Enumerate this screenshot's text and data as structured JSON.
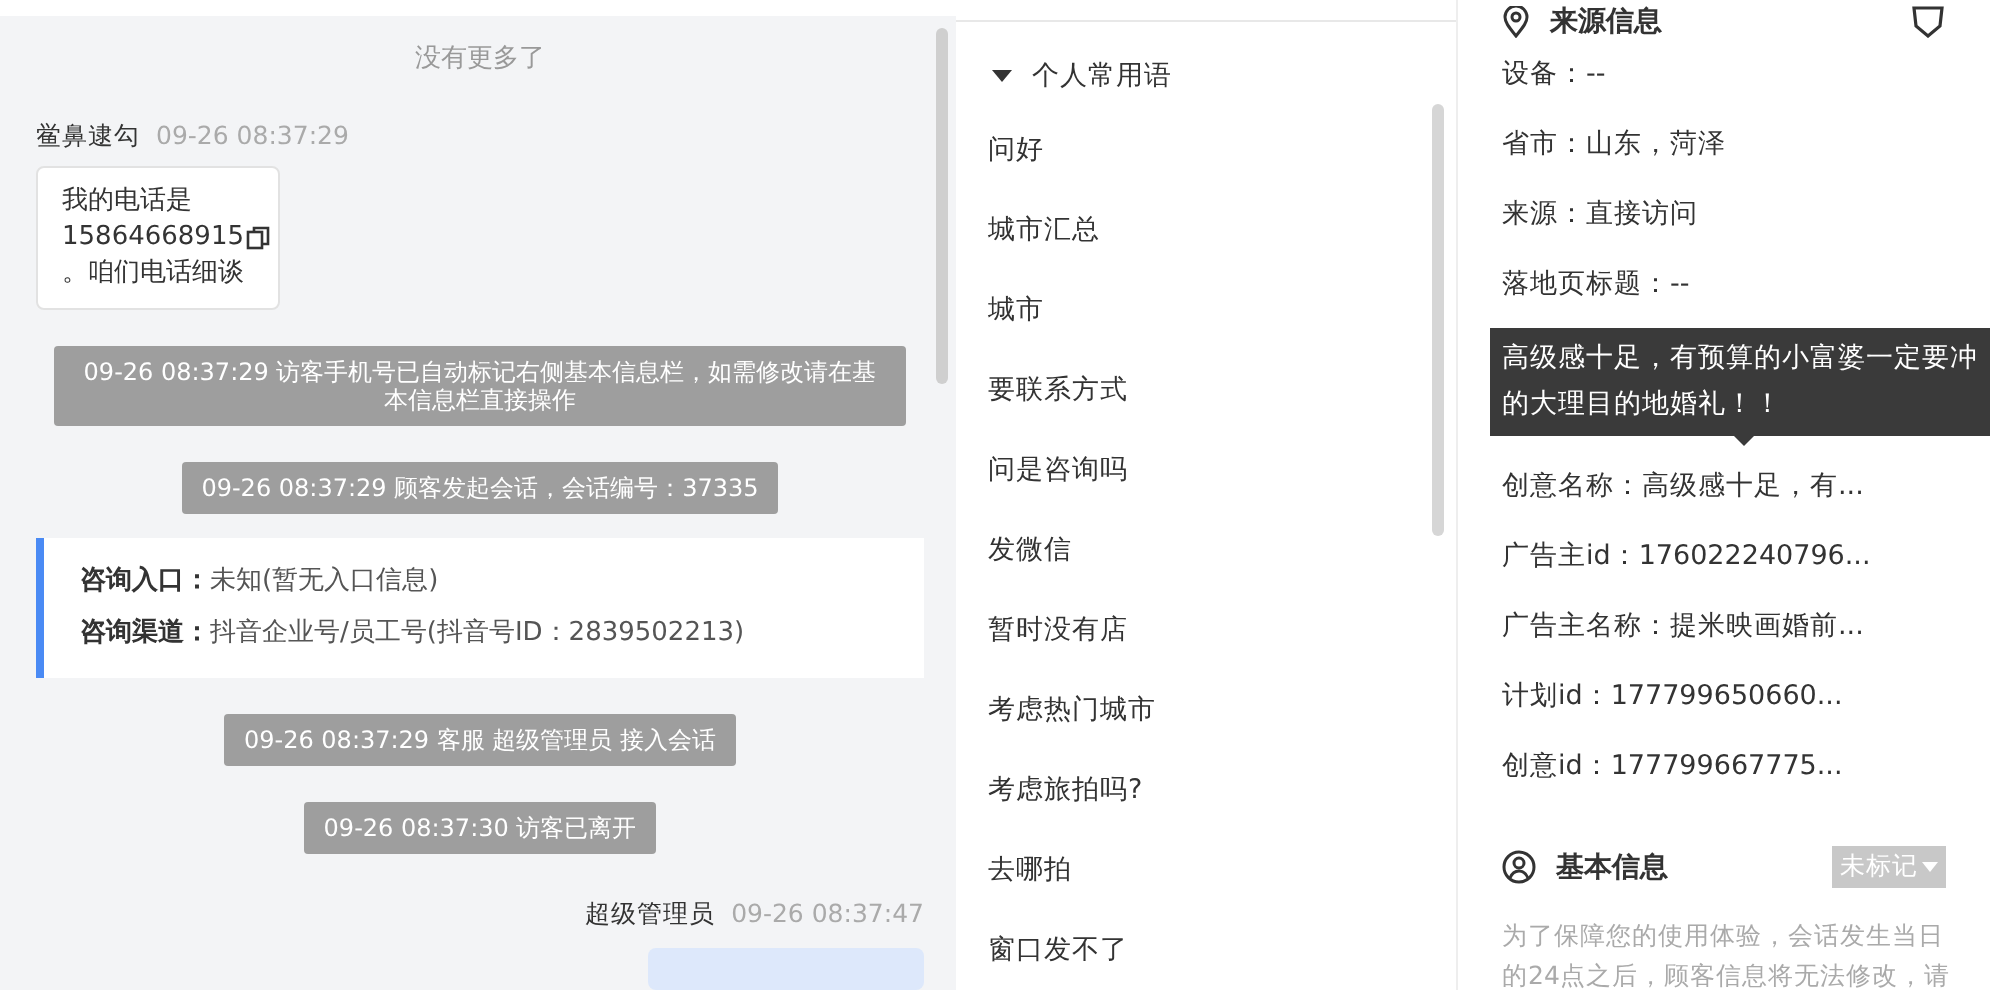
{
  "chat": {
    "no_more": "没有更多了",
    "messages": [
      {
        "kind": "visitor",
        "name": "鲎鼻逮勾",
        "time": "09-26 08:37:29",
        "text_before": "我的电话是",
        "phone": "15864668915",
        "text_after": "。咱们电话细谈"
      },
      {
        "kind": "system",
        "text": "09-26 08:37:29 访客手机号已自动标记右侧基本信息栏，如需修改请在基本信息栏直接操作",
        "wide": true
      },
      {
        "kind": "system",
        "text": "09-26 08:37:29 顾客发起会话，会话编号：37335",
        "wide": false
      },
      {
        "kind": "info",
        "rows": [
          {
            "label": "咨询入口：",
            "value": "未知(暂无入口信息)"
          },
          {
            "label": "咨询渠道：",
            "value": "抖音企业号/员工号(抖音号ID：2839502213)"
          }
        ]
      },
      {
        "kind": "system",
        "text": "09-26 08:37:29 客服 超级管理员 接入会话",
        "wide": false
      },
      {
        "kind": "system",
        "text": "09-26 08:37:30 访客已离开",
        "wide": false
      },
      {
        "kind": "agent",
        "name": "超级管理员",
        "time": "09-26 08:37:47"
      }
    ]
  },
  "phrases": {
    "group": {
      "label": "个人常用语",
      "expanded": true
    },
    "items": [
      "问好",
      "城市汇总",
      "城市",
      "要联系方式",
      "问是咨询吗",
      "发微信",
      "暂时没有店",
      "考虑热门城市",
      "考虑旅拍吗?",
      "去哪拍",
      "窗口发不了"
    ]
  },
  "source": {
    "title": "来源信息",
    "rows": [
      {
        "kind": "row",
        "text": "设备：--"
      },
      {
        "kind": "row",
        "text": "省市：山东，菏泽"
      },
      {
        "kind": "row",
        "text": "来源：直接访问"
      },
      {
        "kind": "row",
        "text": "落地页标题：--"
      },
      {
        "kind": "tooltip",
        "text": "高级感十足，有预算的小富婆一定要冲的大理目的地婚礼！！"
      },
      {
        "kind": "row",
        "text": "创意名称：高级感十足，有..."
      },
      {
        "kind": "row",
        "text": "广告主id：176022240796..."
      },
      {
        "kind": "row",
        "text": "广告主名称：提米映画婚前..."
      },
      {
        "kind": "row",
        "text": "计划id：177799650660..."
      },
      {
        "kind": "row",
        "text": "创意id：177799667775..."
      }
    ]
  },
  "basic": {
    "title": "基本信息",
    "tag": "未标记",
    "notice": "为了保障您的使用体验，会话发生当日的24点之后，顾客信息将无法修改，请"
  }
}
